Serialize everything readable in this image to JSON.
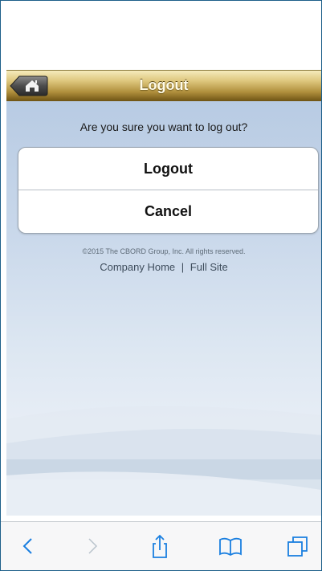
{
  "header": {
    "title": "Logout"
  },
  "dialog": {
    "question": "Are you sure you want to log out?",
    "logout_label": "Logout",
    "cancel_label": "Cancel"
  },
  "footer": {
    "copyright": "©2015 The CBORD Group, Inc. All rights reserved.",
    "company_home": "Company Home",
    "separator": "|",
    "full_site": "Full Site"
  },
  "toolbar": {
    "icons": [
      "back-icon",
      "forward-icon",
      "share-icon",
      "bookmarks-icon",
      "tabs-icon"
    ]
  },
  "colors": {
    "accent": "#1a7fe0",
    "header_gold": "#b08f3c",
    "background_blue": "#c8d7ea"
  }
}
